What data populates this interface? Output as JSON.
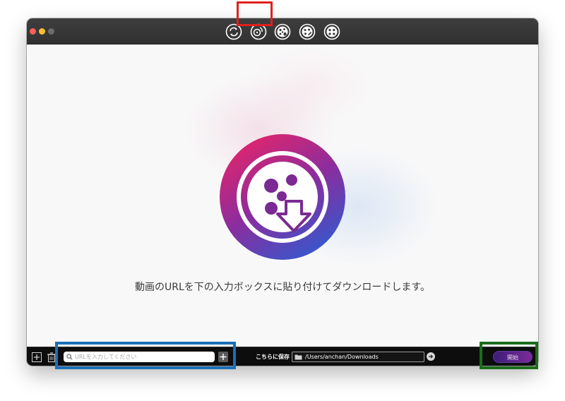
{
  "toolbar": {
    "tools": [
      {
        "icon": "convert-icon"
      },
      {
        "icon": "disc-burn-icon"
      },
      {
        "icon": "video-download-icon",
        "selected": true
      },
      {
        "icon": "video-edit-icon"
      },
      {
        "icon": "video-record-icon"
      }
    ]
  },
  "main": {
    "instruction": "動画のURLを下の入力ボックスに貼り付けてダウンロードします。"
  },
  "bottom": {
    "url_placeholder": "URLを入力してください",
    "save_label": "こちらに保存",
    "save_path": "/Users/anchan/Downloads",
    "start_label": "開始"
  },
  "colors": {
    "accent_pink": "#e1206e",
    "accent_purple": "#5a2ea8",
    "accent_blue": "#3459c9",
    "highlight_red": "#e0201d",
    "highlight_blue": "#1b6fb6",
    "highlight_green": "#1b6d1b"
  }
}
